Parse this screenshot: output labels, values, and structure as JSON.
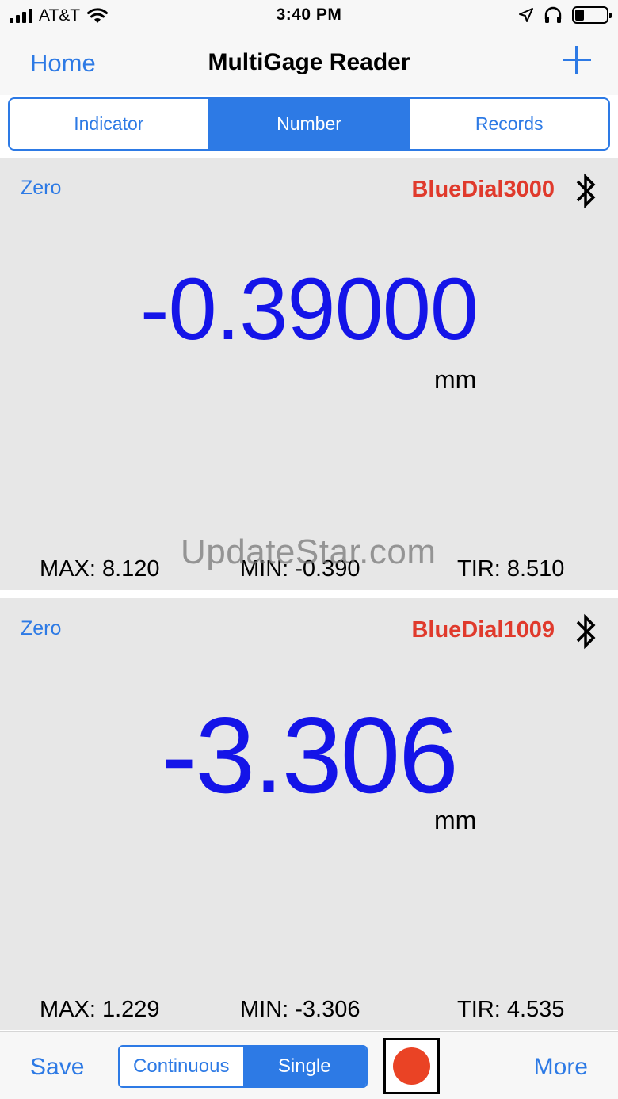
{
  "status_bar": {
    "carrier": "AT&T",
    "time": "3:40 PM",
    "icons": [
      "signal-bars-icon",
      "wifi-icon",
      "location-arrow-icon",
      "headphones-icon",
      "battery-icon"
    ]
  },
  "nav": {
    "back_label": "Home",
    "title": "MultiGage Reader",
    "add_icon": "plus-icon"
  },
  "tabs": [
    {
      "label": "Indicator",
      "active": false
    },
    {
      "label": "Number",
      "active": true
    },
    {
      "label": "Records",
      "active": false
    }
  ],
  "gages": [
    {
      "zero_label": "Zero",
      "device": "BlueDial3000",
      "connection_icon": "bluetooth-icon",
      "reading": "-0.39000",
      "unit": "mm",
      "max": "MAX: 8.120",
      "min": "MIN: -0.390",
      "tir": "TIR: 8.510"
    },
    {
      "zero_label": "Zero",
      "device": "BlueDial1009",
      "connection_icon": "bluetooth-icon",
      "reading": "-3.306",
      "unit": "mm",
      "max": "MAX: 1.229",
      "min": "MIN: -3.306",
      "tir": "TIR: 4.535"
    }
  ],
  "watermark": "UpdateStar.com",
  "toolbar": {
    "save_label": "Save",
    "mode_options": [
      {
        "label": "Continuous",
        "active": false
      },
      {
        "label": "Single",
        "active": true
      }
    ],
    "record_icon": "record-icon",
    "more_label": "More"
  },
  "colors": {
    "accent": "#2d7ae5",
    "reading": "#1414e8",
    "device_name": "#e03a2c",
    "record": "#ea4325",
    "panel_bg": "#e7e7e7"
  }
}
